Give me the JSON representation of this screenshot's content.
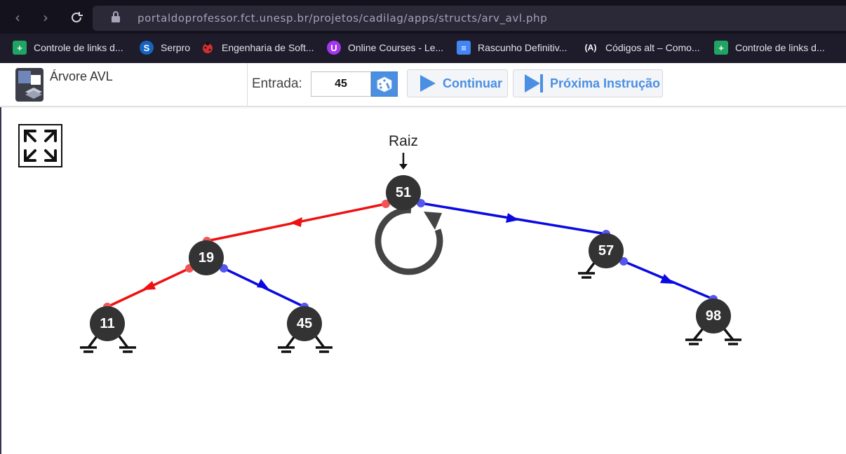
{
  "browser": {
    "url": "portaldoprofessor.fct.unesp.br/projetos/cadilag/apps/structs/arv_avl.php",
    "bookmarks": [
      {
        "label": "Controle de links d...",
        "icon": "google-sheets-icon",
        "color": "#1fa463"
      },
      {
        "label": "Serpro",
        "icon": "serpro-icon",
        "color": "#1565c0"
      },
      {
        "label": "Engenharia de Soft...",
        "icon": "ladybug-icon",
        "color": "#d32f2f"
      },
      {
        "label": "Online Courses - Le...",
        "icon": "udemy-icon",
        "color": "#a435f0"
      },
      {
        "label": "Rascunho Definitiv...",
        "icon": "google-docs-icon",
        "color": "#4285f4"
      },
      {
        "label": "Códigos alt – Como...",
        "icon": "alt-codes-icon",
        "color": "#1e1b2b"
      },
      {
        "label": "Controle de links d...",
        "icon": "google-sheets-icon",
        "color": "#1fa463"
      }
    ]
  },
  "app": {
    "title": "Árvore AVL",
    "entrada_label": "Entrada:",
    "entrada_value": "45",
    "continuar_label": "Continuar",
    "proxima_label": "Próxima Instrução",
    "accent": "#4a8fe2"
  },
  "tree": {
    "root_label": "Raiz",
    "nodes": [
      {
        "id": "n51",
        "value": "51"
      },
      {
        "id": "n19",
        "value": "19"
      },
      {
        "id": "n57",
        "value": "57"
      },
      {
        "id": "n11",
        "value": "11"
      },
      {
        "id": "n45",
        "value": "45"
      },
      {
        "id": "n98",
        "value": "98"
      }
    ],
    "left_edge_color": "#ee1111",
    "right_edge_color": "#0a0ae0",
    "node_color": "#333333",
    "rotation_icon": "rotate-icon"
  }
}
